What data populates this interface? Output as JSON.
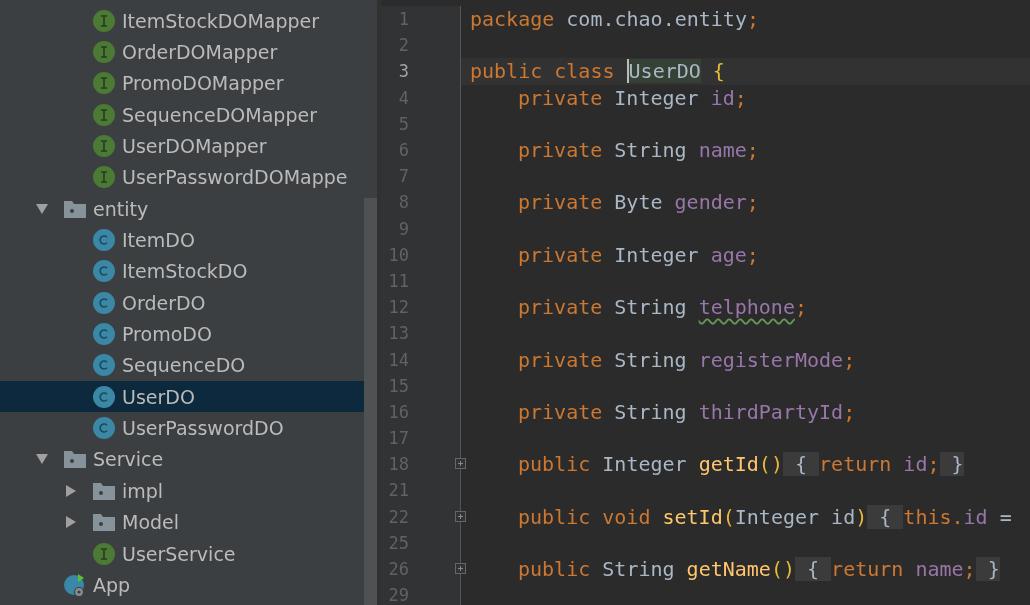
{
  "project_tree": {
    "continued_items": [
      {
        "kind": "interface",
        "label": "ItemStockDOMapper",
        "selected": false
      },
      {
        "kind": "interface",
        "label": "OrderDOMapper",
        "selected": false
      },
      {
        "kind": "interface",
        "label": "PromoDOMapper",
        "selected": false
      },
      {
        "kind": "interface",
        "label": "SequenceDOMapper",
        "selected": false
      },
      {
        "kind": "interface",
        "label": "UserDOMapper",
        "selected": false
      },
      {
        "kind": "interface",
        "label": "UserPasswordDOMappe",
        "selected": false
      }
    ],
    "items": [
      {
        "kind": "folder",
        "label": "entity",
        "expanded": true,
        "selected": false,
        "children": [
          {
            "kind": "class",
            "label": "ItemDO",
            "selected": false
          },
          {
            "kind": "class",
            "label": "ItemStockDO",
            "selected": false
          },
          {
            "kind": "class",
            "label": "OrderDO",
            "selected": false
          },
          {
            "kind": "class",
            "label": "PromoDO",
            "selected": false
          },
          {
            "kind": "class",
            "label": "SequenceDO",
            "selected": false
          },
          {
            "kind": "class",
            "label": "UserDO",
            "selected": true
          },
          {
            "kind": "class",
            "label": "UserPasswordDO",
            "selected": false
          }
        ]
      },
      {
        "kind": "folder",
        "label": "Service",
        "expanded": true,
        "selected": false,
        "children": [
          {
            "kind": "folder",
            "label": "impl",
            "expanded": false,
            "selected": false
          },
          {
            "kind": "folder",
            "label": "Model",
            "expanded": false,
            "selected": false
          },
          {
            "kind": "interface",
            "label": "UserService",
            "selected": false
          }
        ]
      },
      {
        "kind": "app",
        "label": "App",
        "selected": false
      }
    ]
  },
  "editor": {
    "lines": [
      {
        "number": "1",
        "current": false,
        "folded": false,
        "tokens": [
          {
            "text": "package ",
            "kind": "keyword"
          },
          {
            "text": "com.chao.entity",
            "kind": "plain"
          },
          {
            "text": ";",
            "kind": "keyword"
          }
        ]
      },
      {
        "number": "2",
        "current": false
      },
      {
        "number": "3",
        "current": true,
        "folded": false,
        "tokens": [
          {
            "text": "public class ",
            "kind": "keyword"
          },
          {
            "text": "UserDO",
            "kind": "highlight"
          },
          {
            "text": " {",
            "kind": "brace"
          }
        ],
        "children": [
          {
            "number": "4",
            "current": false,
            "folded": false,
            "tokens": [
              {
                "text": "private ",
                "kind": "keyword"
              },
              {
                "text": "Integer ",
                "kind": "plain"
              },
              {
                "text": "id",
                "kind": "field"
              },
              {
                "text": ";",
                "kind": "keyword"
              }
            ]
          },
          {
            "number": "5",
            "current": false
          },
          {
            "number": "6",
            "current": false,
            "folded": false,
            "tokens": [
              {
                "text": "private ",
                "kind": "keyword"
              },
              {
                "text": "String ",
                "kind": "plain"
              },
              {
                "text": "name",
                "kind": "field"
              },
              {
                "text": ";",
                "kind": "keyword"
              }
            ]
          },
          {
            "number": "7",
            "current": false
          },
          {
            "number": "8",
            "current": false,
            "folded": false,
            "tokens": [
              {
                "text": "private ",
                "kind": "keyword"
              },
              {
                "text": "Byte ",
                "kind": "plain"
              },
              {
                "text": "gender",
                "kind": "field"
              },
              {
                "text": ";",
                "kind": "keyword"
              }
            ]
          },
          {
            "number": "9",
            "current": false
          },
          {
            "number": "10",
            "current": false,
            "folded": false,
            "tokens": [
              {
                "text": "private ",
                "kind": "keyword"
              },
              {
                "text": "Integer ",
                "kind": "plain"
              },
              {
                "text": "age",
                "kind": "field"
              },
              {
                "text": ";",
                "kind": "keyword"
              }
            ]
          },
          {
            "number": "11",
            "current": false
          },
          {
            "number": "12",
            "current": false,
            "folded": false,
            "tokens": [
              {
                "text": "private ",
                "kind": "keyword"
              },
              {
                "text": "String ",
                "kind": "plain"
              },
              {
                "text": "telphone",
                "kind": "typo"
              },
              {
                "text": ";",
                "kind": "keyword"
              }
            ]
          },
          {
            "number": "13",
            "current": false
          },
          {
            "number": "14",
            "current": false,
            "folded": false,
            "tokens": [
              {
                "text": "private ",
                "kind": "keyword"
              },
              {
                "text": "String ",
                "kind": "plain"
              },
              {
                "text": "registerMode",
                "kind": "field"
              },
              {
                "text": ";",
                "kind": "keyword"
              }
            ]
          },
          {
            "number": "15",
            "current": false
          },
          {
            "number": "16",
            "current": false,
            "folded": false,
            "tokens": [
              {
                "text": "private ",
                "kind": "keyword"
              },
              {
                "text": "String ",
                "kind": "plain"
              },
              {
                "text": "thirdPartyId",
                "kind": "field"
              },
              {
                "text": ";",
                "kind": "keyword"
              }
            ]
          },
          {
            "number": "17",
            "current": false
          },
          {
            "number": "18",
            "current": false,
            "folded": true,
            "tokens": [
              {
                "text": "public ",
                "kind": "keyword"
              },
              {
                "text": "Integer ",
                "kind": "plain"
              },
              {
                "text": "getId",
                "kind": "method"
              },
              {
                "text": "()",
                "kind": "brace"
              },
              {
                "text": " { ",
                "kind": "fold"
              },
              {
                "text": "return ",
                "kind": "keyword"
              },
              {
                "text": "id",
                "kind": "field"
              },
              {
                "text": ";",
                "kind": "keyword"
              },
              {
                "text": " }",
                "kind": "fold"
              }
            ]
          },
          {
            "number": "21",
            "current": false
          },
          {
            "number": "22",
            "current": false,
            "folded": true,
            "tokens": [
              {
                "text": "public void ",
                "kind": "keyword"
              },
              {
                "text": "setId",
                "kind": "method"
              },
              {
                "text": "(",
                "kind": "brace"
              },
              {
                "text": "Integer id",
                "kind": "plain"
              },
              {
                "text": ")",
                "kind": "brace"
              },
              {
                "text": " { ",
                "kind": "fold"
              },
              {
                "text": "this.",
                "kind": "keyword"
              },
              {
                "text": "id",
                "kind": "field"
              },
              {
                "text": " =",
                "kind": "plain"
              }
            ]
          },
          {
            "number": "25",
            "current": false
          },
          {
            "number": "26",
            "current": false,
            "folded": true,
            "tokens": [
              {
                "text": "public ",
                "kind": "keyword"
              },
              {
                "text": "String ",
                "kind": "plain"
              },
              {
                "text": "getName",
                "kind": "method"
              },
              {
                "text": "()",
                "kind": "brace"
              },
              {
                "text": " { ",
                "kind": "fold"
              },
              {
                "text": "return ",
                "kind": "keyword"
              },
              {
                "text": "name",
                "kind": "field"
              },
              {
                "text": ";",
                "kind": "keyword"
              },
              {
                "text": " }",
                "kind": "fold"
              }
            ]
          },
          {
            "number": "29",
            "current": false
          }
        ]
      }
    ]
  }
}
